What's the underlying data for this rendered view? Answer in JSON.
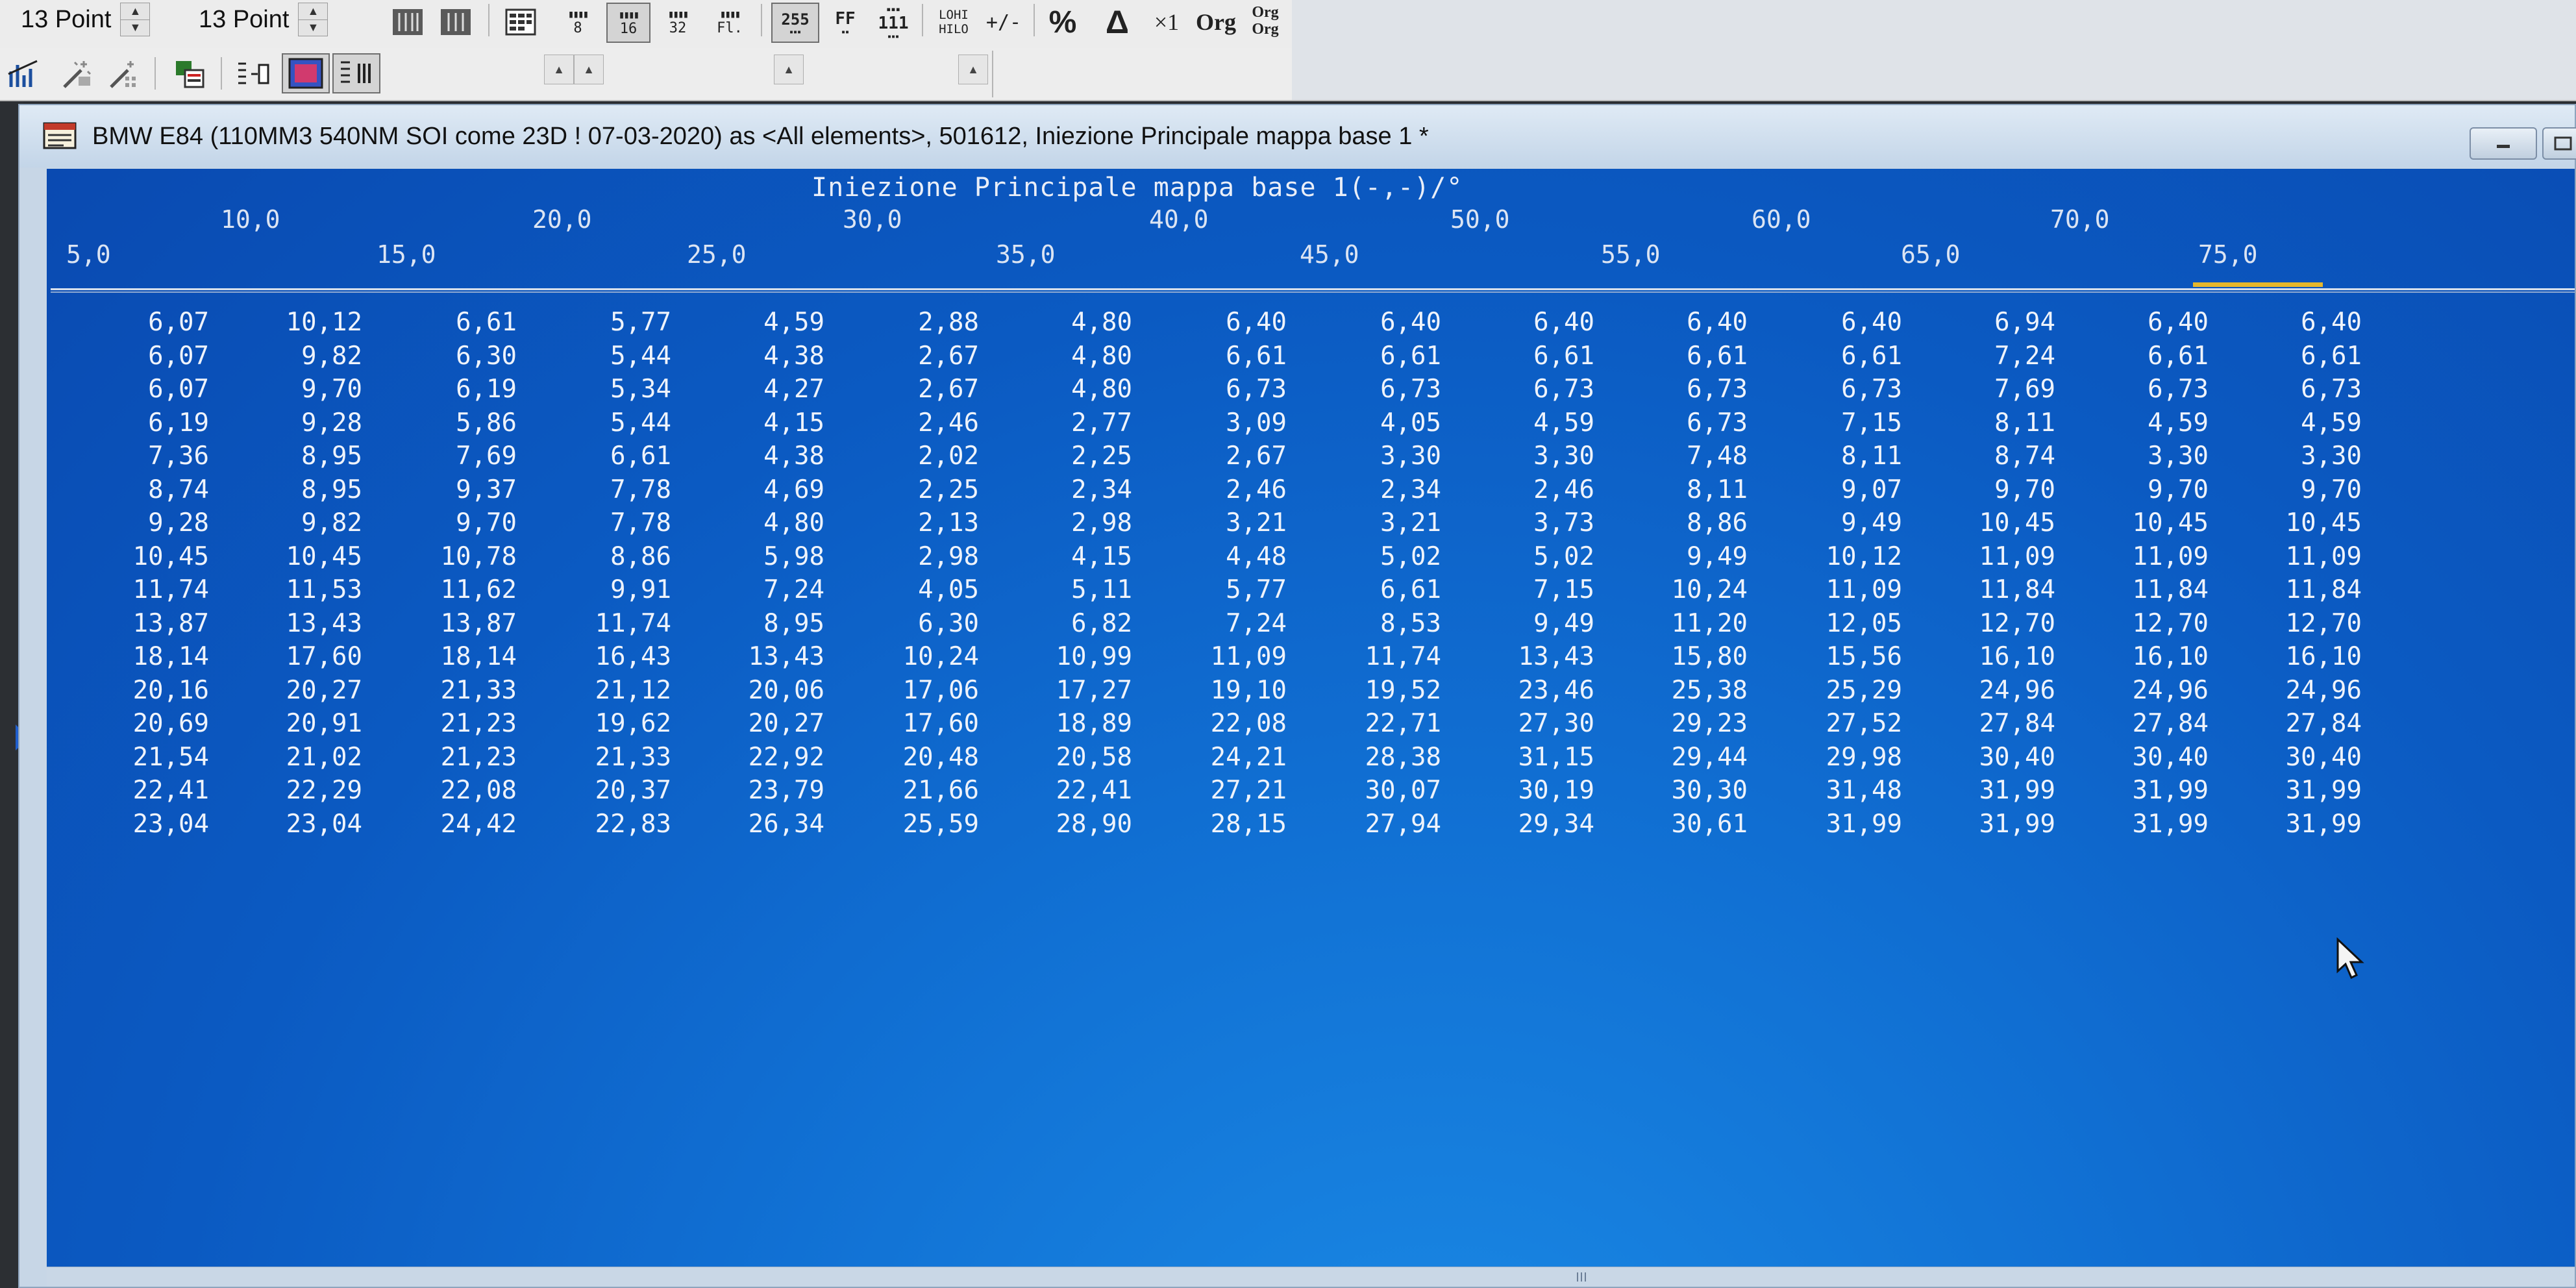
{
  "toolbar1": {
    "font_combo_1": "13 Point",
    "font_combo_2": "13 Point",
    "btn_8": "8",
    "btn_16": "16",
    "btn_32": "32",
    "btn_fl": "Fl.",
    "btn_255": "255",
    "btn_ff": "FF",
    "btn_111": "111",
    "btn_lohi": "LOHI",
    "btn_hilo": "HILO",
    "btn_plusminus": "+/-",
    "btn_percent": "%",
    "btn_delta": "Δ",
    "btn_x1": "×1",
    "btn_org": "Org",
    "btn_org2_top": "Org",
    "btn_org2_bottom": "Org"
  },
  "window": {
    "title": "BMW E84 (110MM3 540NM SOI come 23D ! 07-03-2020) as <All elements>, 501612, Iniezione Principale mappa base 1 *"
  },
  "map": {
    "title": "Iniezione Principale mappa base 1(-,-)/°",
    "x_axis_upper": [
      "10,0",
      "20,0",
      "30,0",
      "40,0",
      "50,0",
      "60,0",
      "70,0"
    ],
    "x_axis_lower": [
      "5,0",
      "15,0",
      "25,0",
      "35,0",
      "45,0",
      "55,0",
      "65,0",
      "75,0"
    ],
    "rows": [
      [
        "6,07",
        "10,12",
        "6,61",
        "5,77",
        "4,59",
        "2,88",
        "4,80",
        "6,40",
        "6,40",
        "6,40",
        "6,40",
        "6,40",
        "6,94",
        "6,40",
        "6,40"
      ],
      [
        "6,07",
        "9,82",
        "6,30",
        "5,44",
        "4,38",
        "2,67",
        "4,80",
        "6,61",
        "6,61",
        "6,61",
        "6,61",
        "6,61",
        "7,24",
        "6,61",
        "6,61"
      ],
      [
        "6,07",
        "9,70",
        "6,19",
        "5,34",
        "4,27",
        "2,67",
        "4,80",
        "6,73",
        "6,73",
        "6,73",
        "6,73",
        "6,73",
        "7,69",
        "6,73",
        "6,73"
      ],
      [
        "6,19",
        "9,28",
        "5,86",
        "5,44",
        "4,15",
        "2,46",
        "2,77",
        "3,09",
        "4,05",
        "4,59",
        "6,73",
        "7,15",
        "8,11",
        "4,59",
        "4,59"
      ],
      [
        "7,36",
        "8,95",
        "7,69",
        "6,61",
        "4,38",
        "2,02",
        "2,25",
        "2,67",
        "3,30",
        "3,30",
        "7,48",
        "8,11",
        "8,74",
        "3,30",
        "3,30"
      ],
      [
        "8,74",
        "8,95",
        "9,37",
        "7,78",
        "4,69",
        "2,25",
        "2,34",
        "2,46",
        "2,34",
        "2,46",
        "8,11",
        "9,07",
        "9,70",
        "9,70",
        "9,70"
      ],
      [
        "9,28",
        "9,82",
        "9,70",
        "7,78",
        "4,80",
        "2,13",
        "2,98",
        "3,21",
        "3,21",
        "3,73",
        "8,86",
        "9,49",
        "10,45",
        "10,45",
        "10,45"
      ],
      [
        "10,45",
        "10,45",
        "10,78",
        "8,86",
        "5,98",
        "2,98",
        "4,15",
        "4,48",
        "5,02",
        "5,02",
        "9,49",
        "10,12",
        "11,09",
        "11,09",
        "11,09"
      ],
      [
        "11,74",
        "11,53",
        "11,62",
        "9,91",
        "7,24",
        "4,05",
        "5,11",
        "5,77",
        "6,61",
        "7,15",
        "10,24",
        "11,09",
        "11,84",
        "11,84",
        "11,84"
      ],
      [
        "13,87",
        "13,43",
        "13,87",
        "11,74",
        "8,95",
        "6,30",
        "6,82",
        "7,24",
        "8,53",
        "9,49",
        "11,20",
        "12,05",
        "12,70",
        "12,70",
        "12,70"
      ],
      [
        "18,14",
        "17,60",
        "18,14",
        "16,43",
        "13,43",
        "10,24",
        "10,99",
        "11,09",
        "11,74",
        "13,43",
        "15,80",
        "15,56",
        "16,10",
        "16,10",
        "16,10"
      ],
      [
        "20,16",
        "20,27",
        "21,33",
        "21,12",
        "20,06",
        "17,06",
        "17,27",
        "19,10",
        "19,52",
        "23,46",
        "25,38",
        "25,29",
        "24,96",
        "24,96",
        "24,96"
      ],
      [
        "20,69",
        "20,91",
        "21,23",
        "19,62",
        "20,27",
        "17,60",
        "18,89",
        "22,08",
        "22,71",
        "27,30",
        "29,23",
        "27,52",
        "27,84",
        "27,84",
        "27,84"
      ],
      [
        "21,54",
        "21,02",
        "21,23",
        "21,33",
        "22,92",
        "20,48",
        "20,58",
        "24,21",
        "28,38",
        "31,15",
        "29,44",
        "29,98",
        "30,40",
        "30,40",
        "30,40"
      ],
      [
        "22,41",
        "22,29",
        "22,08",
        "20,37",
        "23,79",
        "21,66",
        "22,41",
        "27,21",
        "30,07",
        "30,19",
        "30,30",
        "31,48",
        "31,99",
        "31,99",
        "31,99"
      ],
      [
        "23,04",
        "23,04",
        "24,42",
        "22,83",
        "26,34",
        "25,59",
        "28,90",
        "28,15",
        "27,94",
        "29,34",
        "30,61",
        "31,99",
        "31,99",
        "31,99",
        "31,99"
      ]
    ],
    "selected_column": "75,0"
  },
  "colors": {
    "map_background": "#0b5ac2",
    "selection_marker": "#e5b72b",
    "toolbar_background": "#ececec"
  }
}
